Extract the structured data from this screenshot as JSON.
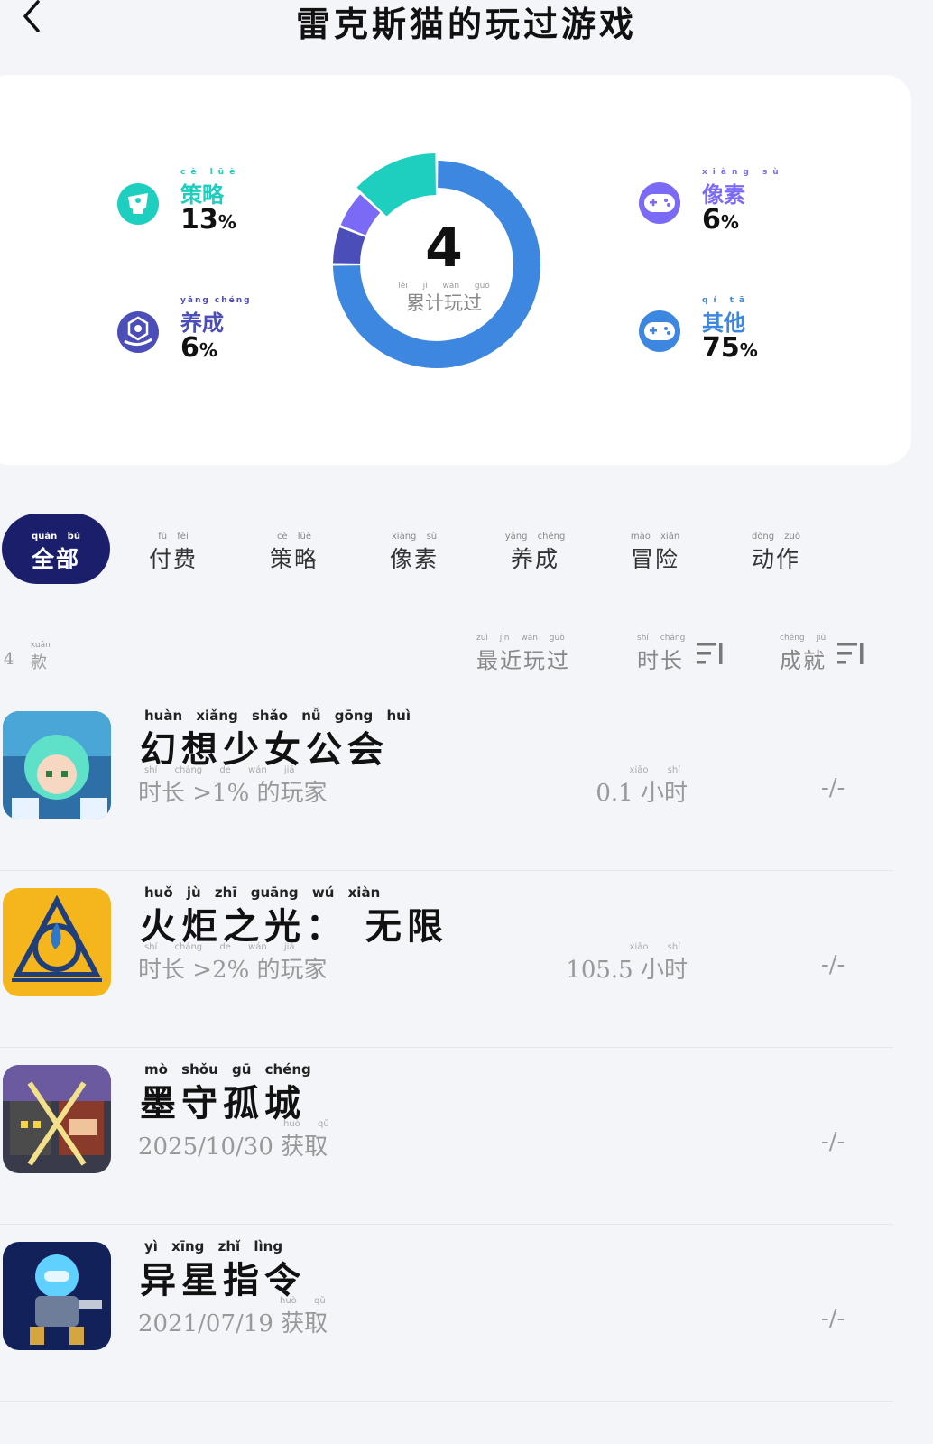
{
  "header": {
    "title": "雷克斯猫的玩过游戏",
    "back_icon": "chevron-left-icon"
  },
  "summary": {
    "total": "4",
    "total_label_py": "lěi jì wán guò",
    "total_label": "累计玩过",
    "segments": [
      {
        "key": "strategy",
        "name_py": "cè lüè",
        "name": "策略",
        "percent": "13",
        "unit": "%",
        "color": "#1ecfc0",
        "value": 13,
        "icon": "strategy-hat-icon"
      },
      {
        "key": "nurture",
        "name_py": "yǎng chéng",
        "name": "养成",
        "percent": "6",
        "unit": "%",
        "color": "#4b4db8",
        "value": 6,
        "icon": "nurture-gem-icon"
      },
      {
        "key": "pixel",
        "name_py": "xiàng sù",
        "name": "像素",
        "percent": "6",
        "unit": "%",
        "color": "#7b6af5",
        "value": 6,
        "icon": "gamepad-icon"
      },
      {
        "key": "other",
        "name_py": "qí tā",
        "name": "其他",
        "percent": "75",
        "unit": "%",
        "color": "#3d87e0",
        "value": 75,
        "icon": "gamepad-icon"
      }
    ]
  },
  "tabs": [
    {
      "py": "quán bù",
      "label": "全部",
      "active": true
    },
    {
      "py": "fù fèi",
      "label": "付费"
    },
    {
      "py": "cè lüè",
      "label": "策略"
    },
    {
      "py": "xiàng sù",
      "label": "像素"
    },
    {
      "py": "yǎng chéng",
      "label": "养成"
    },
    {
      "py": "mào xiǎn",
      "label": "冒险"
    },
    {
      "py": "dòng zuò",
      "label": "动作"
    }
  ],
  "list_header": {
    "count": "4",
    "count_unit_py": "kuǎn",
    "count_unit": "款",
    "sort_recent_py": "zuì jìn wán guò",
    "sort_recent": "最近玩过",
    "sort_duration_py": "shí cháng",
    "sort_duration": "时长",
    "sort_achievement_py": "chéng jiù",
    "sort_achievement": "成就"
  },
  "games": [
    {
      "name_py": "huàn xiǎng shǎo nǚ gōng huì",
      "name": "幻想少女公会",
      "meta_py": "shí cháng          de wán jiā",
      "meta": "时长 >1% 的玩家",
      "hours": "0.1",
      "hours_unit_py": "xiǎo shí",
      "hours_unit": "小时",
      "achievement": "-/-"
    },
    {
      "name_py": "huǒ jù zhī guāng   wú xiàn",
      "name": "火炬之光： 无限",
      "meta_py": "shí cháng          de wán jiā",
      "meta": "时长 >2% 的玩家",
      "hours": "105.5",
      "hours_unit_py": "xiǎo shí",
      "hours_unit": "小时",
      "achievement": "-/-"
    },
    {
      "name_py": "mò shǒu gū chéng",
      "name": "墨守孤城",
      "meta_py": "huò qǔ",
      "meta": "2025/10/30 获取",
      "hours": "",
      "hours_unit_py": "",
      "hours_unit": "",
      "achievement": "-/-"
    },
    {
      "name_py": "yì xīng zhǐ lìng",
      "name": "异星指令",
      "meta_py": "huò qǔ",
      "meta": "2021/07/19 获取",
      "hours": "",
      "hours_unit_py": "",
      "hours_unit": "",
      "achievement": "-/-"
    }
  ]
}
